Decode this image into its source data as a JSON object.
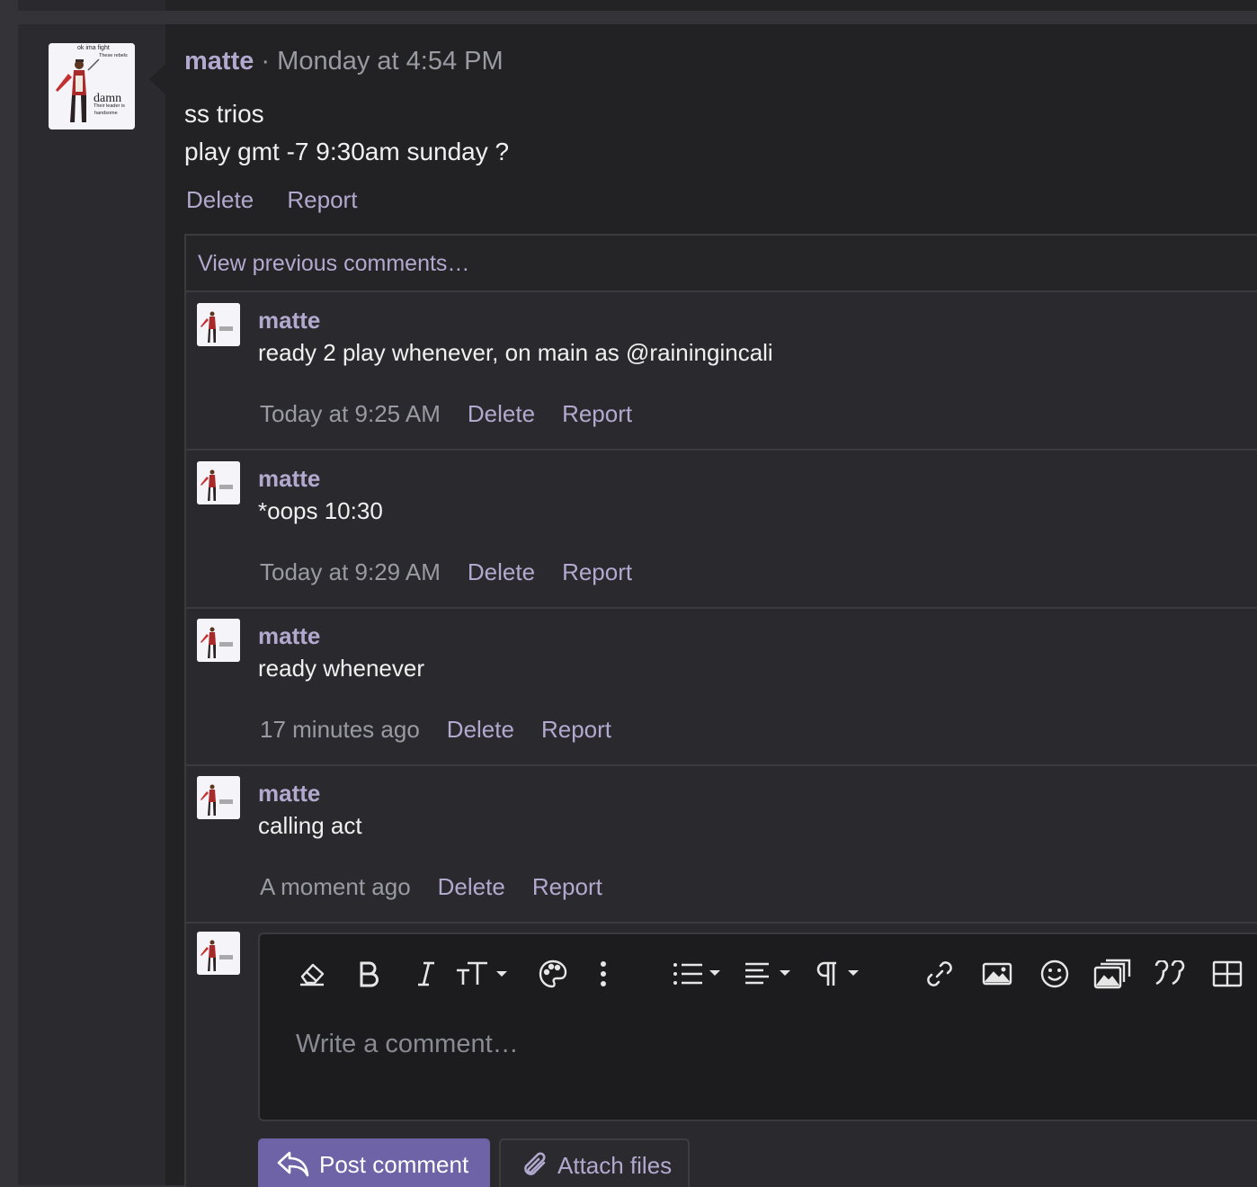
{
  "post": {
    "author": "matte",
    "separator": "·",
    "time": "Monday at 4:54 PM",
    "lines": [
      "ss trios",
      "play gmt -7 9:30am sunday ?"
    ],
    "actions": [
      "Delete",
      "Report"
    ],
    "avatar_text": {
      "line1": "ok ima fight",
      "line2": "These rebels",
      "line3": "damn",
      "line4": "Their leader is",
      "line5": "handsome"
    }
  },
  "comments_section": {
    "view_previous": "View previous comments…",
    "items": [
      {
        "author": "matte",
        "text": "ready 2 play whenever, on main as @rainingincali",
        "time": "Today at 9:25 AM",
        "delete": "Delete",
        "report": "Report"
      },
      {
        "author": "matte",
        "text": "*oops 10:30",
        "time": "Today at 9:29 AM",
        "delete": "Delete",
        "report": "Report"
      },
      {
        "author": "matte",
        "text": "ready whenever",
        "time": "17 minutes ago",
        "delete": "Delete",
        "report": "Report"
      },
      {
        "author": "matte",
        "text": "calling act",
        "time": "A moment ago",
        "delete": "Delete",
        "report": "Report"
      }
    ]
  },
  "reply": {
    "placeholder": "Write a comment…",
    "post_button": "Post comment",
    "attach_button": "Attach files",
    "toolbar_icons": [
      "eraser-icon",
      "bold-icon",
      "italic-icon",
      "text-size-icon",
      "palette-icon",
      "more-vertical-icon",
      "list-icon",
      "align-icon",
      "paragraph-icon",
      "link-icon",
      "image-icon",
      "smiley-icon",
      "media-gallery-icon",
      "quote-icon",
      "table-icon"
    ]
  },
  "colors": {
    "accent": "#b3a9cf",
    "button": "#6f63a8",
    "background": "#222225",
    "muted": "#9a9aa2"
  }
}
